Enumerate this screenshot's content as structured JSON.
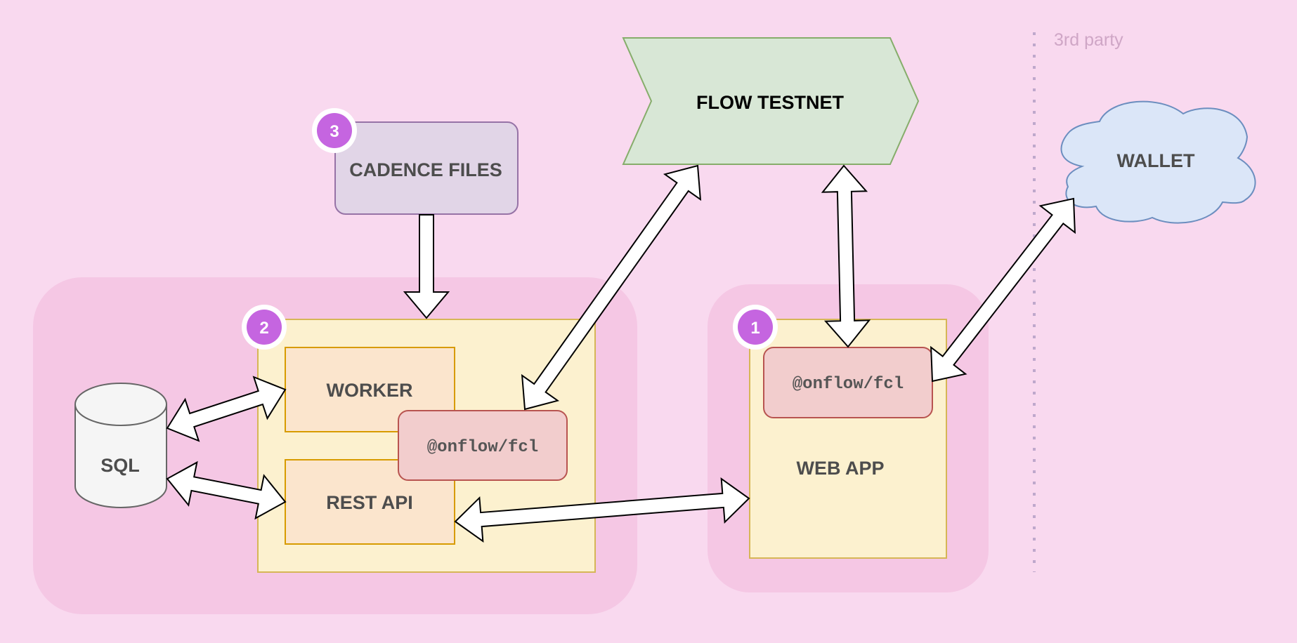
{
  "diagram": {
    "background": "#f9d9ef",
    "zones": {
      "third_party_label": "3rd party",
      "third_party_separator": "dotted"
    },
    "groups": [
      {
        "id": "backend-group",
        "fill": "#f5c7e4"
      },
      {
        "id": "webapp-group",
        "fill": "#f5c7e4"
      }
    ],
    "nodes": {
      "flow_testnet": {
        "label": "FLOW TESTNET",
        "shape": "step-chevron",
        "fill": "#d8e7d6",
        "stroke": "#86ad6b"
      },
      "wallet": {
        "label": "WALLET",
        "shape": "cloud",
        "fill": "#dbe6f8",
        "stroke": "#6c8ebf"
      },
      "cadence_files": {
        "label": "CADENCE FILES",
        "shape": "rounded-rect",
        "fill": "#e1d5e7",
        "stroke": "#9673a6",
        "badge": "3"
      },
      "backend": {
        "shape": "rect",
        "fill": "#fcf1cf",
        "stroke": "#d6b656",
        "badge": "2"
      },
      "worker": {
        "label": "WORKER",
        "shape": "rect",
        "fill": "#fbe5cd",
        "stroke": "#d79b00"
      },
      "rest_api": {
        "label": "REST API",
        "shape": "rect",
        "fill": "#fbe5cd",
        "stroke": "#d79b00"
      },
      "backend_fcl": {
        "label": "@onflow/fcl",
        "shape": "rounded-rect",
        "fill": "#f2cdcd",
        "stroke": "#b85450"
      },
      "sql": {
        "label": "SQL",
        "shape": "cylinder",
        "fill": "#f5f5f5",
        "stroke": "#666666"
      },
      "web_app": {
        "label": "WEB APP",
        "shape": "rect",
        "fill": "#fcf1cf",
        "stroke": "#d6b656",
        "badge": "1"
      },
      "web_fcl": {
        "label": "@onflow/fcl",
        "shape": "rounded-rect",
        "fill": "#f2cdcd",
        "stroke": "#b85450"
      }
    },
    "badge_color": "#c565e0",
    "edges": [
      {
        "from": "cadence_files",
        "to": "backend",
        "type": "block-arrow",
        "direction": "one-way"
      },
      {
        "from": "backend_fcl",
        "to": "flow_testnet",
        "type": "block-arrow",
        "direction": "two-way"
      },
      {
        "from": "flow_testnet",
        "to": "web_fcl",
        "type": "block-arrow",
        "direction": "two-way"
      },
      {
        "from": "web_fcl",
        "to": "wallet",
        "type": "block-arrow",
        "direction": "two-way"
      },
      {
        "from": "sql",
        "to": "worker",
        "type": "block-arrow",
        "direction": "two-way"
      },
      {
        "from": "sql",
        "to": "rest_api",
        "type": "block-arrow",
        "direction": "two-way"
      },
      {
        "from": "rest_api",
        "to": "web_app",
        "type": "block-arrow",
        "direction": "two-way"
      }
    ]
  }
}
